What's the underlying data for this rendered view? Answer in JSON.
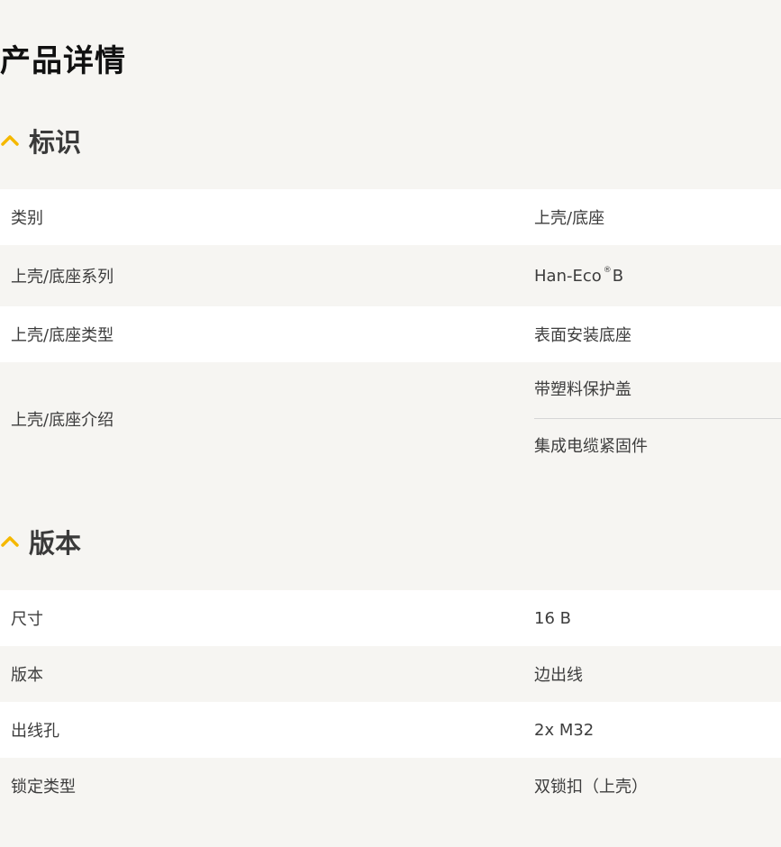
{
  "page": {
    "title": "产品详情"
  },
  "sections": {
    "identification": {
      "heading": "标识",
      "rows": [
        {
          "label": "类别",
          "value": "上壳/底座"
        },
        {
          "label": "上壳/底座系列",
          "value": "Han-Eco",
          "value_sup": "®",
          "value_suffix": "B"
        },
        {
          "label": "上壳/底座类型",
          "value": "表面安装底座"
        },
        {
          "label": "上壳/底座介绍",
          "values": [
            "带塑料保护盖",
            "集成电缆紧固件"
          ]
        }
      ]
    },
    "version": {
      "heading": "版本",
      "rows": [
        {
          "label": "尺寸",
          "value": "16 B"
        },
        {
          "label": "版本",
          "value": "边出线"
        },
        {
          "label": "出线孔",
          "value": "2x M32"
        },
        {
          "label": "锁定类型",
          "value": "双锁扣（上壳）"
        }
      ]
    }
  },
  "colors": {
    "accent": "#f5b800",
    "background": "#f6f5f2",
    "row_white": "#ffffff",
    "title": "#111111",
    "text": "#3d3d3d",
    "divider": "#d6d6d6"
  },
  "icons": {
    "section_toggle": "chevron-up-icon"
  }
}
